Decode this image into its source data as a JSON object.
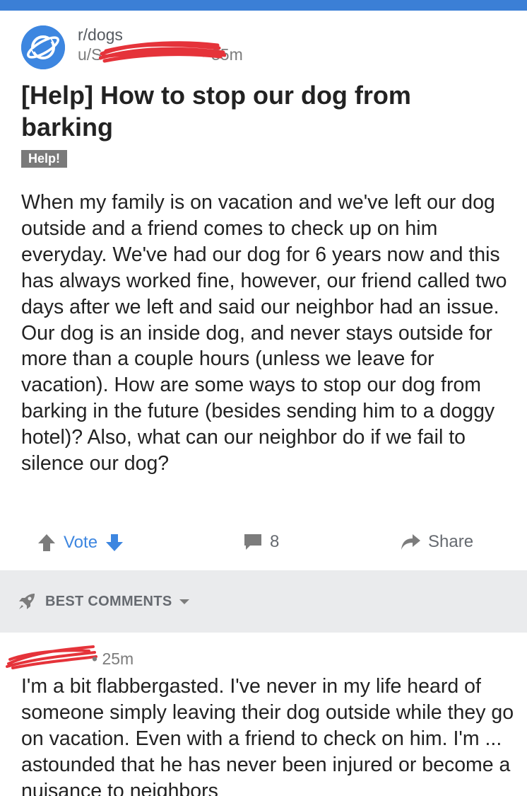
{
  "header": {
    "subreddit": "r/dogs",
    "user": "u/S",
    "age_sep": "•",
    "age": "35m"
  },
  "post": {
    "title": "[Help] How to stop our dog from barking",
    "flair": "Help!",
    "body": "When my family is on vacation and we've left our dog outside and a friend comes to check up on him everyday. We've had our dog for 6 years now and this has always worked fine, however, our friend called two days after we left and said our neighbor had an issue. Our dog is an inside dog, and never stays outside for more than a couple hours (unless we leave for vacation). How are some ways to stop our dog from barking in the future (besides sending him to a doggy hotel)? Also, what can our neighbor do if we fail to silence our dog?"
  },
  "actions": {
    "vote_label": "Vote",
    "comments_count": "8",
    "share_label": "Share"
  },
  "comments_section": {
    "sort_label": "BEST COMMENTS"
  },
  "comment": {
    "age": "• 25m",
    "body": "I'm a bit flabbergasted.  I've never in my life heard of someone simply leaving their dog outside while they go on vacation.  Even with a friend to check on him.  I'm ... astounded that he has never been injured or become a nuisance to neighbors"
  },
  "colors": {
    "accent_blue": "#3d86e0",
    "top_bar": "#3b7fd6",
    "redaction_red": "#e5333a",
    "flair_bg": "#7a7a7a",
    "section_bg": "#eaebed"
  },
  "icons": {
    "avatar": "planet-icon",
    "upvote": "arrow-up-icon",
    "downvote": "arrow-down-icon",
    "comments": "comment-bubble-icon",
    "share": "share-arrow-icon",
    "sort": "rocket-icon",
    "dropdown": "caret-down-icon"
  }
}
